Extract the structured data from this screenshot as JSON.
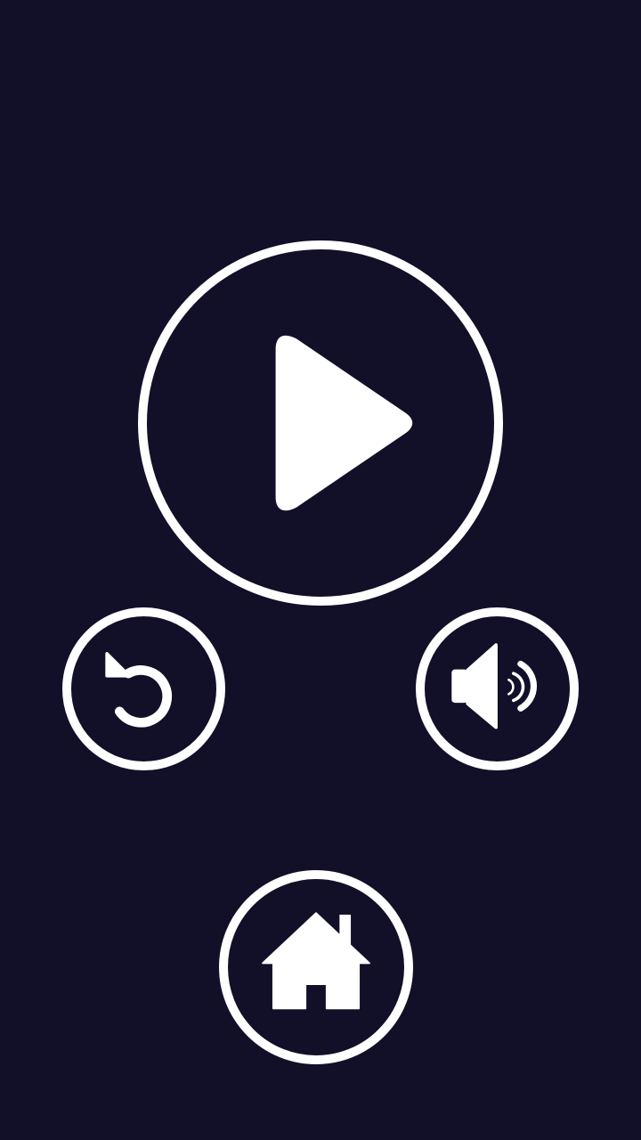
{
  "theme": {
    "background": "#120f28",
    "foreground": "#ffffff"
  },
  "menu": {
    "buttons": [
      {
        "id": "play",
        "icon": "play-icon"
      },
      {
        "id": "restart",
        "icon": "restart-icon"
      },
      {
        "id": "sound",
        "icon": "speaker-on-icon",
        "state": "on"
      },
      {
        "id": "home",
        "icon": "home-icon"
      }
    ]
  }
}
